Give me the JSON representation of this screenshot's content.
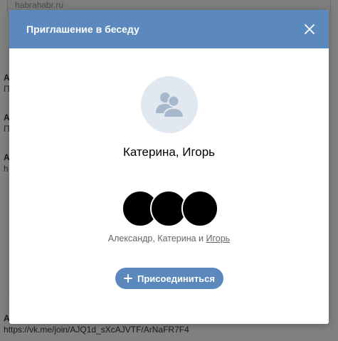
{
  "background": {
    "top_input_text": "habrahabr.ru",
    "fragments": [
      {
        "text": "А"
      },
      {
        "text": "П"
      },
      {
        "text": "А"
      },
      {
        "text": "П"
      },
      {
        "text": "А"
      },
      {
        "text": "h"
      }
    ],
    "bottom_name": "А",
    "bottom_link": "https://vk.me/join/AJQ1d_sXcAJVTF/ArNaFR7F4"
  },
  "modal": {
    "title": "Приглашение в беседу",
    "chat_name": "Катерина, Игорь",
    "members_prefix": "Александр, Катерина и ",
    "members_link": "Игорь",
    "join_label": "Присоединиться"
  },
  "colors": {
    "header": "#5b88bd",
    "button": "#5b88bd",
    "avatar_bg": "#e1e8ef",
    "avatar_icon": "#a7b8cc"
  },
  "icons": {
    "close": "close-icon",
    "group": "group-users-icon",
    "plus": "plus-icon"
  }
}
